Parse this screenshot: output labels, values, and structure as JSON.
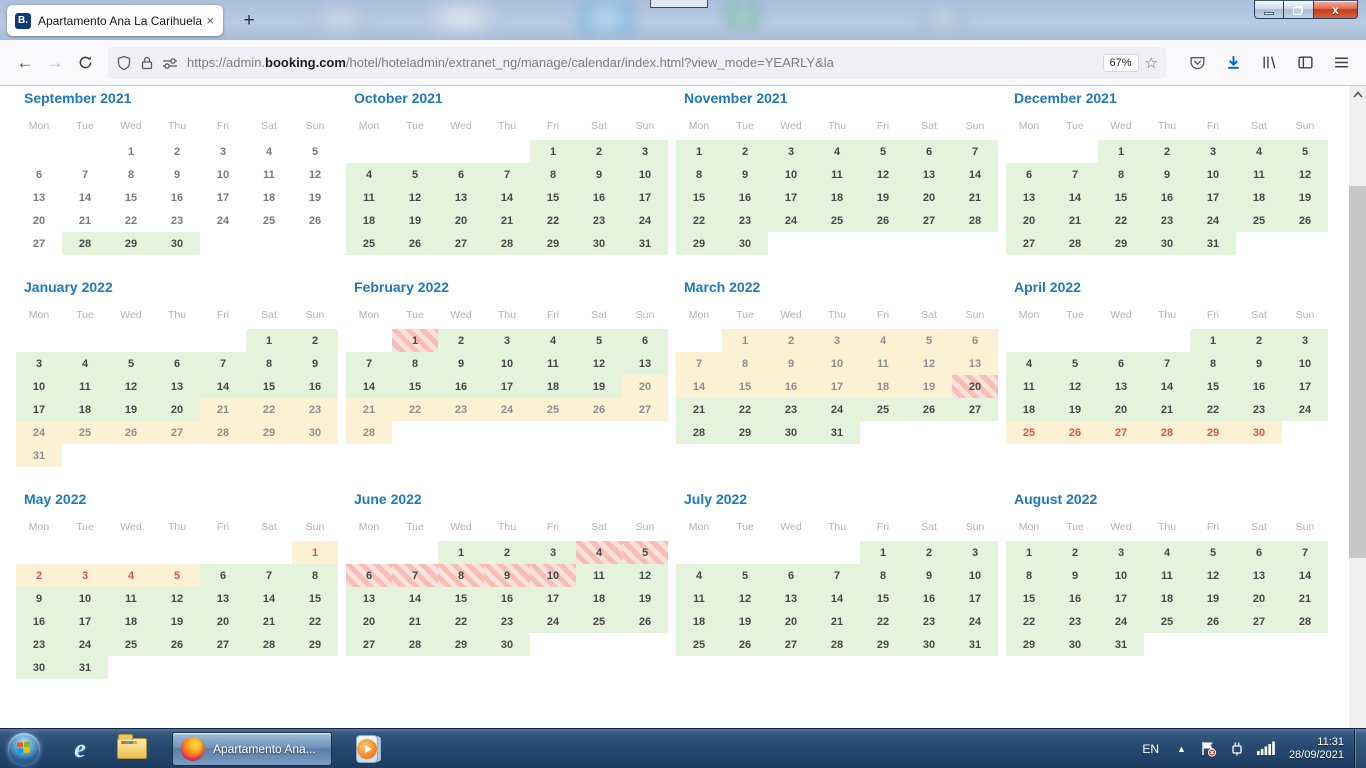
{
  "window": {
    "tab_title": "Apartamento Ana La Carihuela",
    "favicon_letter": "B."
  },
  "icons": {
    "close_window": "x",
    "close_tab": "×",
    "new_tab": "+",
    "back": "←",
    "forward": "→",
    "star": "☆",
    "tray_arrow": "▲"
  },
  "browser": {
    "url_prefix": "https://admin.",
    "url_domain": "booking.com",
    "url_path": "/hotel/hoteladmin/extranet_ng/manage/calendar/index.html?view_mode=YEARLY&la",
    "zoom_badge": "67%"
  },
  "calendar": {
    "weekdays": [
      "Mon",
      "Tue",
      "Wed",
      "Thu",
      "Fri",
      "Sat",
      "Sun"
    ],
    "status_colors": {
      "avail_bg": "#e4f4dc",
      "closed_bg": "#fcf1d2",
      "soldout_text": "#e0544c",
      "booked_stripe": "#f5bdb4",
      "title_blue": "#1d79c0"
    },
    "months": [
      {
        "name": "September 2021",
        "first_dow": 2,
        "days": 30,
        "ranges": [
          {
            "from": 1,
            "to": 27,
            "status": "past"
          },
          {
            "from": 28,
            "to": 30,
            "status": "avail"
          }
        ]
      },
      {
        "name": "October 2021",
        "first_dow": 4,
        "days": 31,
        "ranges": [
          {
            "from": 1,
            "to": 31,
            "status": "avail"
          }
        ]
      },
      {
        "name": "November 2021",
        "first_dow": 0,
        "days": 30,
        "ranges": [
          {
            "from": 1,
            "to": 30,
            "status": "avail"
          }
        ]
      },
      {
        "name": "December 2021",
        "first_dow": 2,
        "days": 31,
        "ranges": [
          {
            "from": 1,
            "to": 31,
            "status": "avail"
          }
        ]
      },
      {
        "name": "January 2022",
        "first_dow": 5,
        "days": 31,
        "ranges": [
          {
            "from": 1,
            "to": 20,
            "status": "avail"
          },
          {
            "from": 21,
            "to": 31,
            "status": "closed"
          }
        ]
      },
      {
        "name": "February 2022",
        "first_dow": 1,
        "days": 28,
        "ranges": [
          {
            "from": 1,
            "to": 1,
            "status": "booked"
          },
          {
            "from": 2,
            "to": 19,
            "status": "avail"
          },
          {
            "from": 20,
            "to": 28,
            "status": "closed"
          }
        ]
      },
      {
        "name": "March 2022",
        "first_dow": 1,
        "days": 31,
        "ranges": [
          {
            "from": 1,
            "to": 19,
            "status": "closed"
          },
          {
            "from": 20,
            "to": 20,
            "status": "booked"
          },
          {
            "from": 21,
            "to": 31,
            "status": "avail"
          }
        ]
      },
      {
        "name": "April 2022",
        "first_dow": 4,
        "days": 30,
        "ranges": [
          {
            "from": 1,
            "to": 24,
            "status": "avail"
          },
          {
            "from": 25,
            "to": 30,
            "status": "soldout"
          }
        ]
      },
      {
        "name": "May 2022",
        "first_dow": 6,
        "days": 31,
        "ranges": [
          {
            "from": 1,
            "to": 5,
            "status": "soldout"
          },
          {
            "from": 6,
            "to": 31,
            "status": "avail"
          }
        ]
      },
      {
        "name": "June 2022",
        "first_dow": 2,
        "days": 30,
        "ranges": [
          {
            "from": 1,
            "to": 3,
            "status": "avail"
          },
          {
            "from": 4,
            "to": 10,
            "status": "booked"
          },
          {
            "from": 11,
            "to": 30,
            "status": "avail"
          }
        ]
      },
      {
        "name": "July 2022",
        "first_dow": 4,
        "days": 31,
        "ranges": [
          {
            "from": 1,
            "to": 31,
            "status": "avail"
          }
        ]
      },
      {
        "name": "August 2022",
        "first_dow": 0,
        "days": 31,
        "ranges": [
          {
            "from": 1,
            "to": 31,
            "status": "avail"
          }
        ]
      }
    ]
  },
  "taskbar": {
    "active_task_label": "Apartamento Ana...",
    "tray": {
      "language": "EN",
      "time": "11:31",
      "date": "28/09/2021"
    }
  }
}
